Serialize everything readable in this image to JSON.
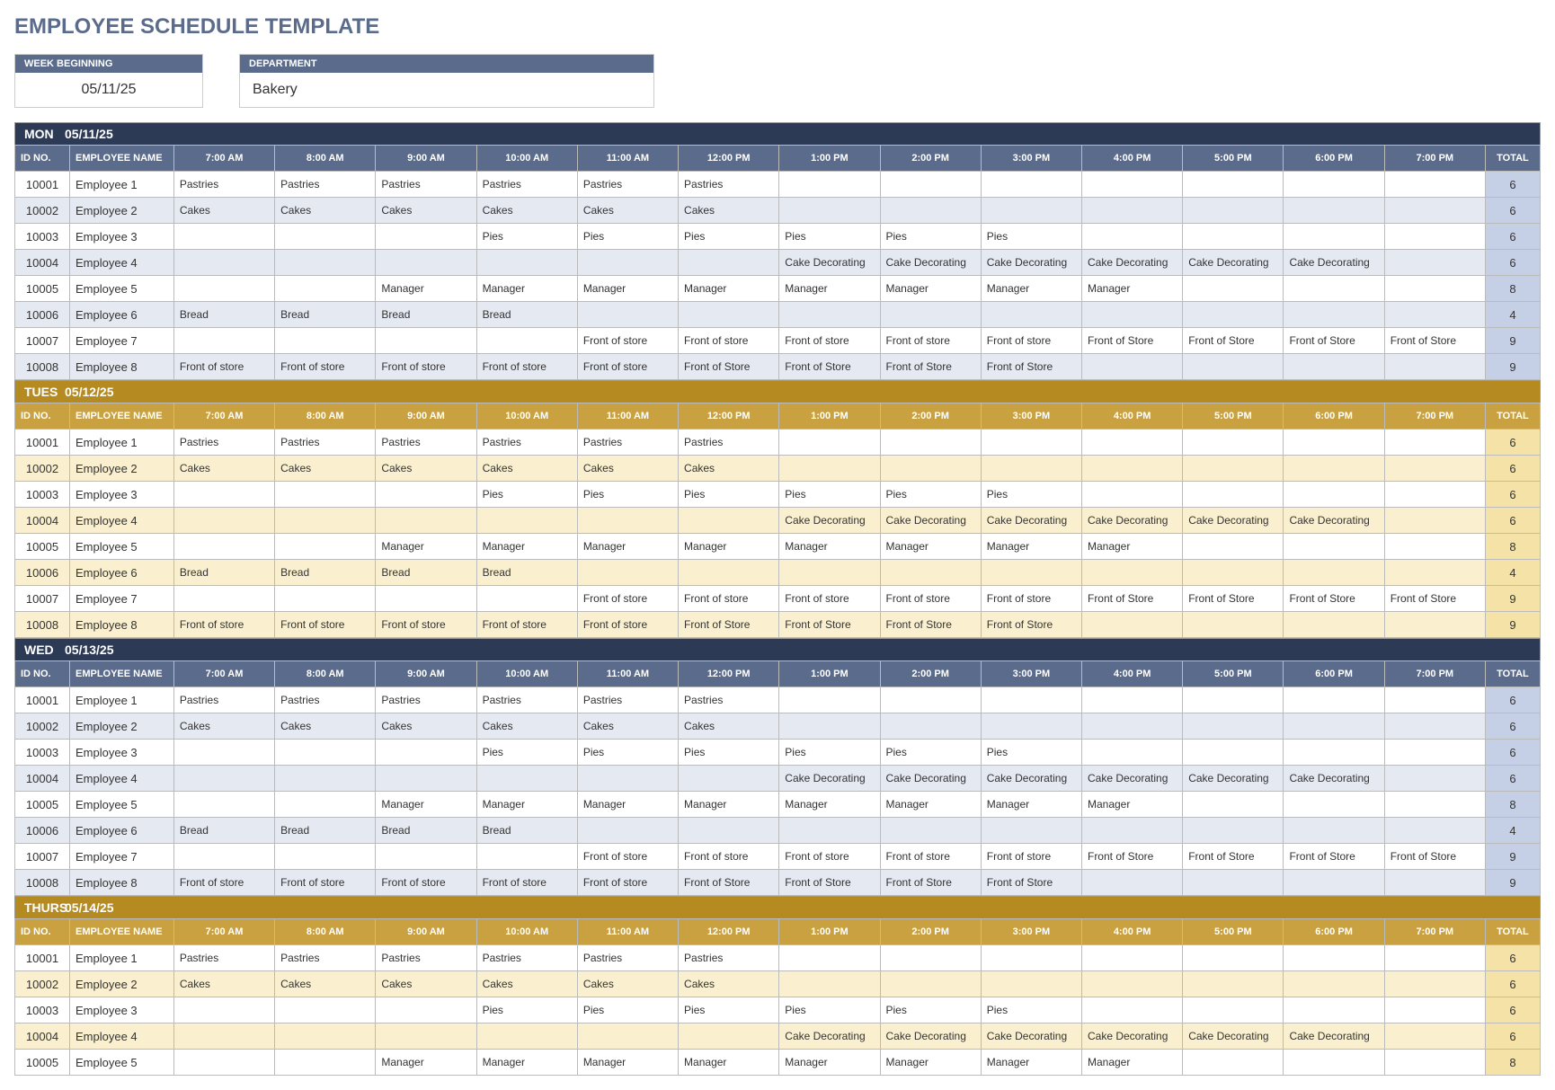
{
  "title": "EMPLOYEE SCHEDULE TEMPLATE",
  "header": {
    "week_begin_label": "WEEK BEGINNING",
    "week_begin_value": "05/11/25",
    "dept_label": "DEPARTMENT",
    "dept_value": "Bakery"
  },
  "cols": {
    "id": "ID NO.",
    "emp": "EMPLOYEE NAME",
    "times": [
      "7:00 AM",
      "8:00 AM",
      "9:00 AM",
      "10:00 AM",
      "11:00 AM",
      "12:00 PM",
      "1:00 PM",
      "2:00 PM",
      "3:00 PM",
      "4:00 PM",
      "5:00 PM",
      "6:00 PM",
      "7:00 PM"
    ],
    "total": "TOTAL"
  },
  "days": [
    {
      "abbr": "MON",
      "date": "05/11/25",
      "theme": "navy",
      "clip": null
    },
    {
      "abbr": "TUES",
      "date": "05/12/25",
      "theme": "gold",
      "clip": null
    },
    {
      "abbr": "WED",
      "date": "05/13/25",
      "theme": "navy",
      "clip": null
    },
    {
      "abbr": "THURS",
      "date": "05/14/25",
      "theme": "gold",
      "clip": 5
    }
  ],
  "rows": [
    {
      "id": "10001",
      "name": "Employee 1",
      "total": "6",
      "slots": [
        "Pastries",
        "Pastries",
        "Pastries",
        "Pastries",
        "Pastries",
        "Pastries",
        "",
        "",
        "",
        "",
        "",
        "",
        ""
      ]
    },
    {
      "id": "10002",
      "name": "Employee 2",
      "total": "6",
      "slots": [
        "Cakes",
        "Cakes",
        "Cakes",
        "Cakes",
        "Cakes",
        "Cakes",
        "",
        "",
        "",
        "",
        "",
        "",
        ""
      ]
    },
    {
      "id": "10003",
      "name": "Employee 3",
      "total": "6",
      "slots": [
        "",
        "",
        "",
        "Pies",
        "Pies",
        "Pies",
        "Pies",
        "Pies",
        "Pies",
        "",
        "",
        "",
        ""
      ]
    },
    {
      "id": "10004",
      "name": "Employee 4",
      "total": "6",
      "slots": [
        "",
        "",
        "",
        "",
        "",
        "",
        "Cake Decorating",
        "Cake Decorating",
        "Cake Decorating",
        "Cake Decorating",
        "Cake Decorating",
        "Cake Decorating",
        ""
      ]
    },
    {
      "id": "10005",
      "name": "Employee 5",
      "total": "8",
      "slots": [
        "",
        "",
        "Manager",
        "Manager",
        "Manager",
        "Manager",
        "Manager",
        "Manager",
        "Manager",
        "Manager",
        "",
        "",
        ""
      ]
    },
    {
      "id": "10006",
      "name": "Employee 6",
      "total": "4",
      "slots": [
        "Bread",
        "Bread",
        "Bread",
        "Bread",
        "",
        "",
        "",
        "",
        "",
        "",
        "",
        "",
        ""
      ]
    },
    {
      "id": "10007",
      "name": "Employee 7",
      "total": "9",
      "slots": [
        "",
        "",
        "",
        "",
        "Front of store",
        "Front of store",
        "Front of store",
        "Front of store",
        "Front of store",
        "Front of Store",
        "Front of Store",
        "Front of Store",
        "Front of Store"
      ]
    },
    {
      "id": "10008",
      "name": "Employee 8",
      "total": "9",
      "slots": [
        "Front of store",
        "Front of store",
        "Front of store",
        "Front of store",
        "Front of store",
        "Front of Store",
        "Front of Store",
        "Front of Store",
        "Front of Store",
        "",
        "",
        "",
        ""
      ]
    }
  ]
}
